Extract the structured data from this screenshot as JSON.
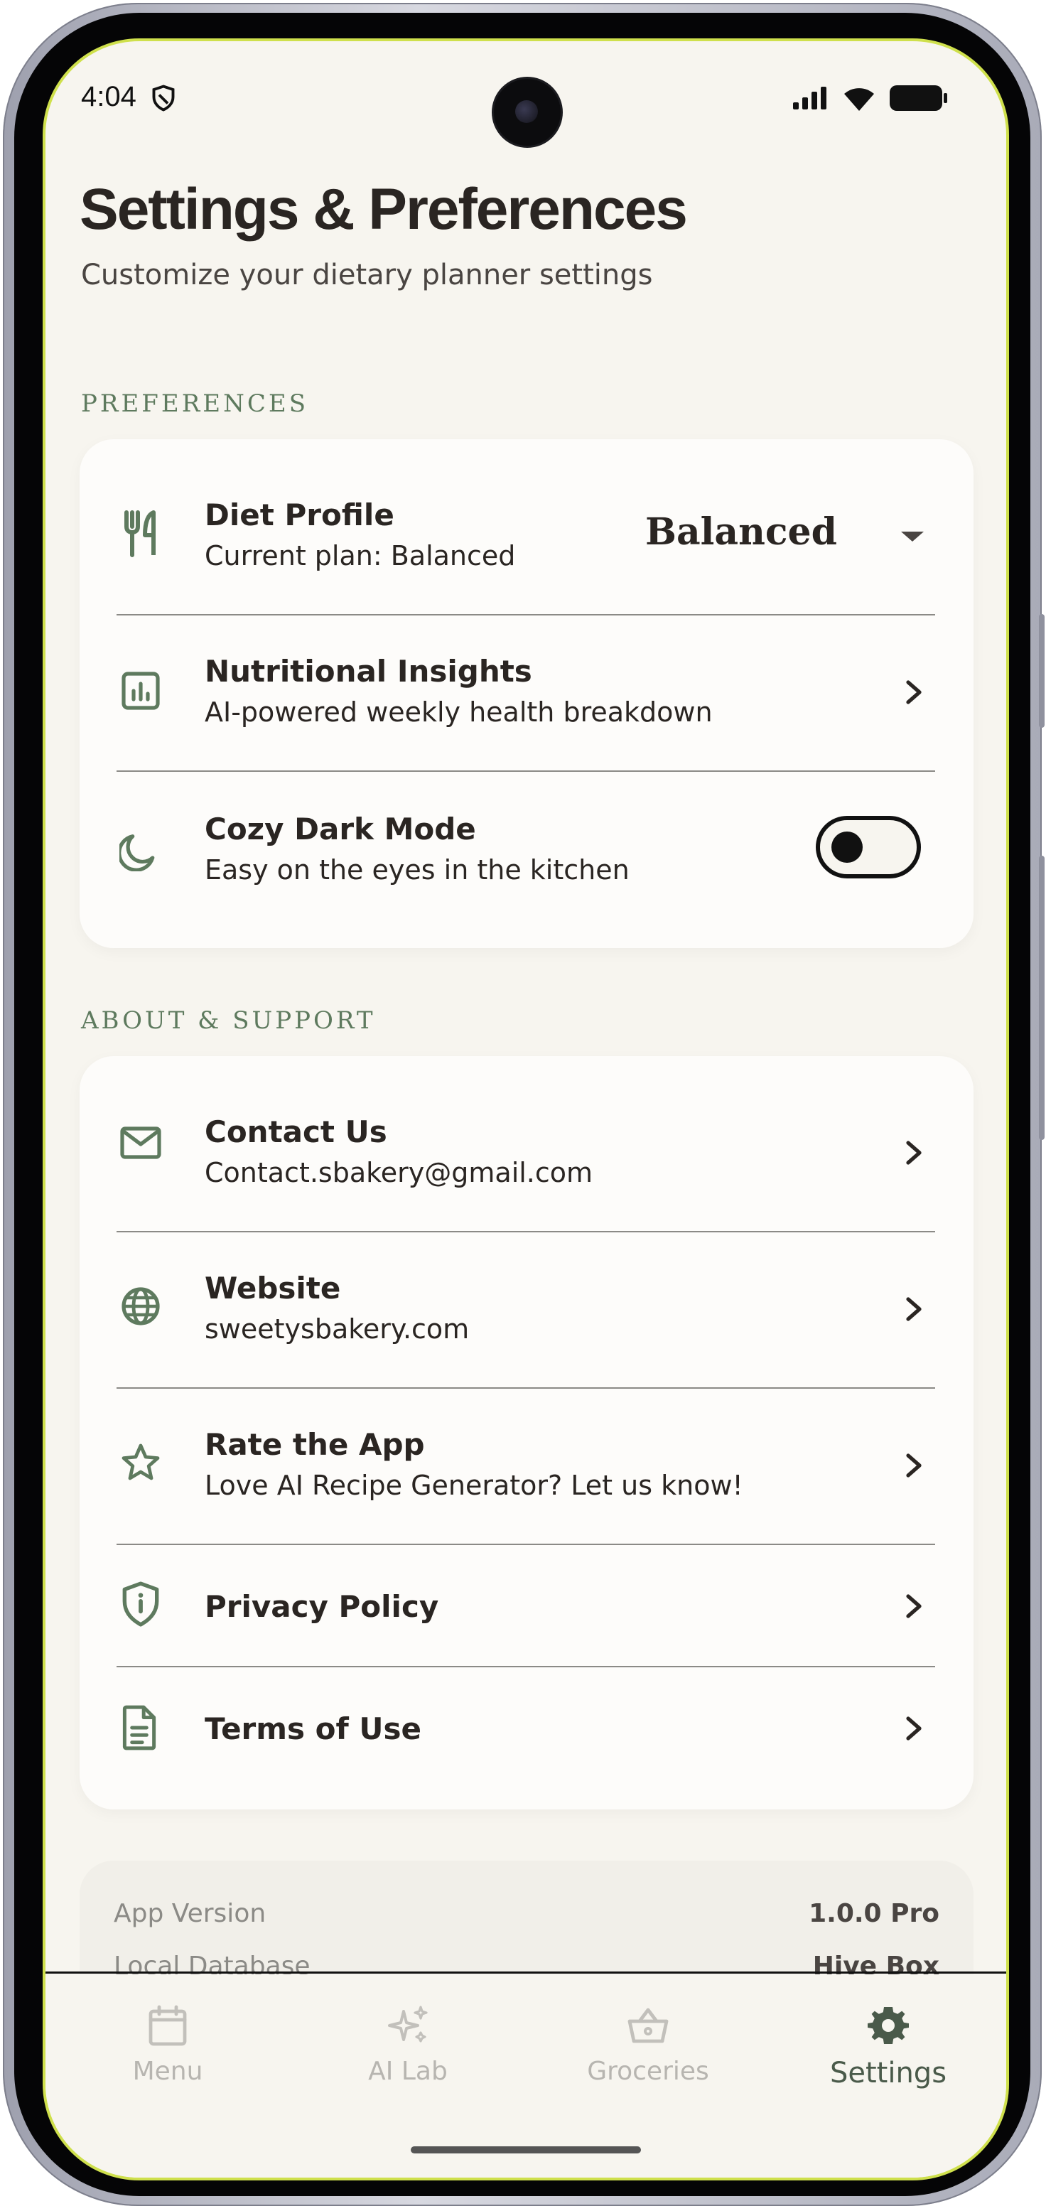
{
  "status_bar": {
    "time": "4:04",
    "icons": [
      "shield-icon",
      "signal-icon",
      "wifi-icon",
      "battery-icon"
    ]
  },
  "header": {
    "title": "Settings & Preferences",
    "subtitle": "Customize your dietary planner settings"
  },
  "preferences": {
    "section_label": "PREFERENCES",
    "diet_profile": {
      "title": "Diet Profile",
      "subtitle": "Current plan: Balanced",
      "selected": "Balanced",
      "icon": "utensils-icon"
    },
    "nutritional_insights": {
      "title": "Nutritional Insights",
      "subtitle": "AI-powered weekly health breakdown",
      "icon": "chart-icon"
    },
    "dark_mode": {
      "title": "Cozy Dark Mode",
      "subtitle": "Easy on the eyes in the kitchen",
      "icon": "moon-icon",
      "enabled": false
    }
  },
  "about": {
    "section_label": "ABOUT & SUPPORT",
    "items": [
      {
        "title": "Contact Us",
        "subtitle": "Contact.sbakery@gmail.com",
        "icon": "mail-icon"
      },
      {
        "title": "Website",
        "subtitle": "sweetysbakery.com",
        "icon": "globe-icon"
      },
      {
        "title": "Rate the App",
        "subtitle": "Love AI Recipe Generator? Let us know!",
        "icon": "star-icon"
      },
      {
        "title": "Privacy Policy",
        "subtitle": "",
        "icon": "shield-info-icon"
      },
      {
        "title": "Terms of Use",
        "subtitle": "",
        "icon": "document-icon"
      }
    ]
  },
  "app_info": {
    "version_label": "App Version",
    "version_value": "1.0.0 Pro",
    "db_label": "Local Database",
    "db_value": "Hive Box"
  },
  "bottom_nav": {
    "items": [
      {
        "label": "Menu",
        "icon": "calendar-icon",
        "active": false
      },
      {
        "label": "AI Lab",
        "icon": "sparkles-icon",
        "active": false
      },
      {
        "label": "Groceries",
        "icon": "basket-icon",
        "active": false
      },
      {
        "label": "Settings",
        "icon": "gear-icon",
        "active": true
      }
    ]
  },
  "colors": {
    "background": "#f7f5ef",
    "card": "#fdfcfa",
    "accent_green": "#5e7a5e",
    "text_dark": "#2a2522"
  }
}
